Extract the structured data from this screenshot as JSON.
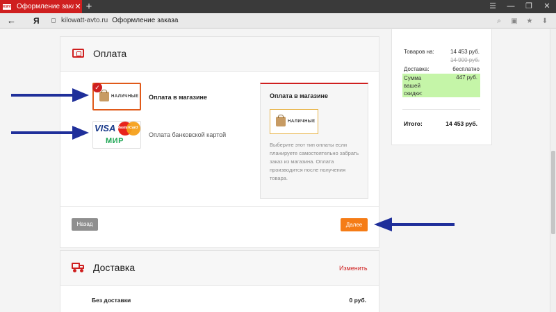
{
  "browser": {
    "tab_favicon": "KWV",
    "tab_title": "Оформление заказа",
    "tab_close": "✕",
    "new_tab": "+",
    "url": "kilowatt-avto.ru",
    "page_title": "Оформление заказа",
    "yandex_logo": "Я",
    "back": "←"
  },
  "payment": {
    "title": "Оплата",
    "cash_badge": "НАЛИЧНЫЕ",
    "options": [
      {
        "label": "Оплата в магазине",
        "selected": true
      },
      {
        "label": "Оплата банковской картой",
        "selected": false
      }
    ],
    "card_logos": {
      "visa": "VISA",
      "mastercard": "MasterCard",
      "mir": "МИР"
    },
    "info": {
      "title": "Оплата в магазине",
      "text": "Выберите этот тип оплаты если планируете самостоятельно забрать заказ из магазина. Оплата производится после получения товара."
    },
    "back_button": "Назад",
    "next_button": "Далее"
  },
  "delivery": {
    "title": "Доставка",
    "change_link": "Изменить",
    "row_name": "Без доставки",
    "row_price": "0 руб."
  },
  "summary": {
    "items_label": "Товаров на:",
    "items_value": "14 453 руб.",
    "items_old_value": "14 900 руб.",
    "delivery_label": "Доставка:",
    "delivery_value": "бесплатно",
    "discount_label": "Сумма вашей скидки:",
    "discount_value": "447 руб.",
    "total_label": "Итого:",
    "total_value": "14 453 руб."
  },
  "colors": {
    "brand_red": "#cf1f1f",
    "accent_orange": "#f57c16",
    "discount_green": "#c5f5a8",
    "arrow_blue": "#1f2f9a"
  }
}
